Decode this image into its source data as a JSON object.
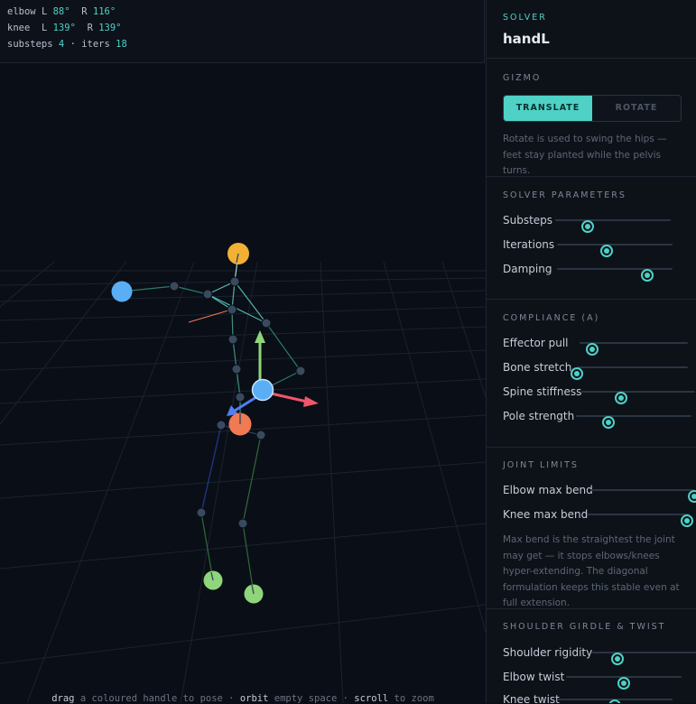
{
  "hud": {
    "elbow": {
      "label": "elbow",
      "left_label": "L",
      "left_value": "88°",
      "right_label": "R",
      "right_value": "116°"
    },
    "knee": {
      "label": "knee",
      "left_label": "L",
      "left_value": "139°",
      "right_label": "R",
      "right_value": "139°"
    },
    "substeps_label": "substeps",
    "substeps_value": "4",
    "sep": "·",
    "iters_label": "iters",
    "iters_value": "18"
  },
  "footer": {
    "drag": "drag",
    "drag_rest": " a coloured handle to pose · ",
    "orbit": "orbit",
    "orbit_rest": " empty space · ",
    "scroll": "scroll",
    "scroll_rest": " to zoom"
  },
  "panel": {
    "solver": {
      "title": "SOLVER",
      "name": "handL"
    },
    "gizmo": {
      "title": "GIZMO",
      "modes": [
        "TRANSLATE",
        "ROTATE"
      ],
      "active_mode": "TRANSLATE",
      "note": "Rotate is used to swing the hips — feet stay planted while the pelvis turns."
    },
    "solver_params": {
      "title": "SOLVER PARAMETERS",
      "sliders": [
        {
          "label": "Substeps",
          "value": 0.28
        },
        {
          "label": "Iterations",
          "value": 0.43
        },
        {
          "label": "Damping",
          "value": 0.78
        }
      ]
    },
    "compliance": {
      "title": "COMPLIANCE (Α)",
      "sliders": [
        {
          "label": "Effector pull",
          "value": 0.12
        },
        {
          "label": "Bone stretch",
          "value": 0.0
        },
        {
          "label": "Spine stiffness",
          "value": 0.35
        },
        {
          "label": "Pole strength",
          "value": 0.28
        }
      ]
    },
    "joint_limits": {
      "title": "JOINT LIMITS",
      "sliders": [
        {
          "label": "Elbow max bend",
          "value": 1.0
        },
        {
          "label": "Knee max bend",
          "value": 0.97
        }
      ],
      "note": "Max bend is the straightest the joint may get — it stops elbows/knees hyper-extending. The diagonal formulation keeps this stable even at full extension."
    },
    "shoulder": {
      "title": "SHOULDER GIRDLE & TWIST",
      "sliders": [
        {
          "label": "Shoulder rigidity",
          "value": 0.25
        },
        {
          "label": "Elbow twist",
          "value": 0.5
        },
        {
          "label": "Knee twist",
          "value": 0.5
        }
      ]
    }
  },
  "colors": {
    "accent": "#4fd1c5",
    "handle_head": "#f2b134",
    "handle_hand": "#5aaef5",
    "handle_hip": "#f07a54",
    "handle_foot": "#8fd57b",
    "gizmo_x": "#f0566a",
    "gizmo_y": "#8fd57b",
    "gizmo_z": "#4f7ff0"
  }
}
